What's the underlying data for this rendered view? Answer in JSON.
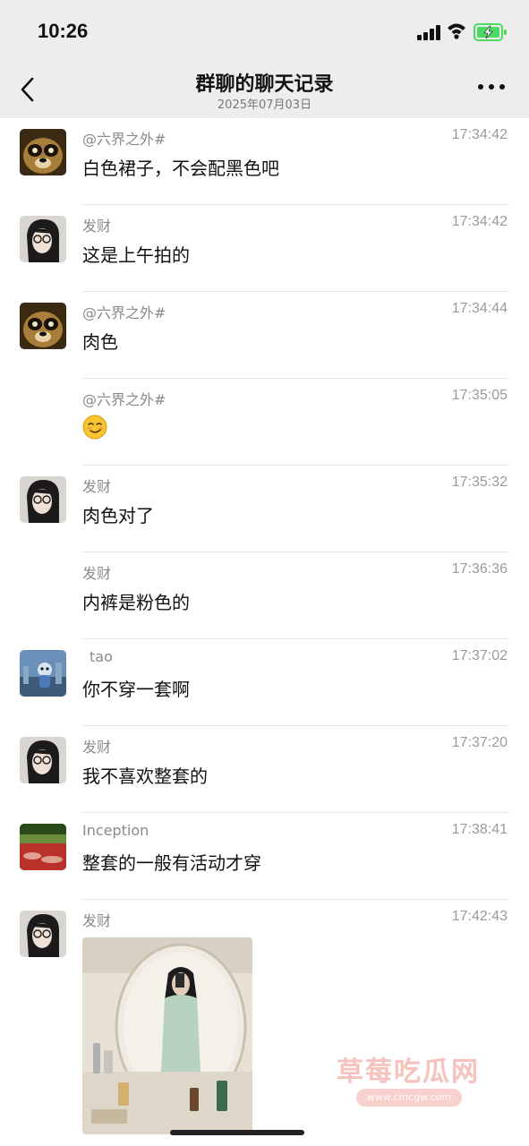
{
  "status": {
    "time": "10:26"
  },
  "header": {
    "title": "群聊的聊天记录",
    "subtitle": "2025年07月03日",
    "back_icon": "chevron-left-icon",
    "more_icon": "more-icon"
  },
  "messages": [
    {
      "sender": "@六界之外#",
      "time": "17:34:42",
      "text": "白色裙子，不会配黑色吧",
      "avatar": "panda"
    },
    {
      "sender": "发财",
      "time": "17:34:42",
      "text": "这是上午拍的",
      "avatar": "girl"
    },
    {
      "sender": "@六界之外#",
      "time": "17:34:44",
      "text": "肉色",
      "avatar": "panda"
    },
    {
      "sender": "@六界之外#",
      "time": "17:35:05",
      "text": "",
      "emoji": "smirk-emoji",
      "avatar": ""
    },
    {
      "sender": "发财",
      "time": "17:35:32",
      "text": "肉色对了",
      "avatar": "girl"
    },
    {
      "sender": "发财",
      "time": "17:36:36",
      "text": "内裤是粉色的",
      "avatar": ""
    },
    {
      "sender": "tao",
      "time": "17:37:02",
      "text": "你不穿一套啊",
      "avatar": "robot"
    },
    {
      "sender": "发财",
      "time": "17:37:20",
      "text": "我不喜欢整套的",
      "avatar": "girl"
    },
    {
      "sender": "Inception",
      "time": "17:38:41",
      "text": "整套的一般有活动才穿",
      "avatar": "landscape"
    },
    {
      "sender": "发财",
      "time": "17:42:43",
      "text": "",
      "image": "mirror-selfie-photo",
      "avatar": "girl"
    }
  ],
  "watermark": {
    "title": "草莓吃瓜网",
    "url": "www.cmcgw.com"
  }
}
